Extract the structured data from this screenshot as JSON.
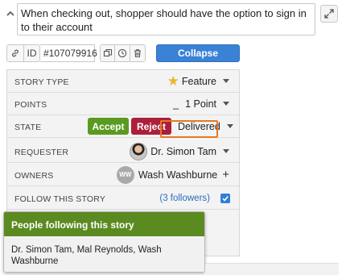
{
  "story": {
    "title": "When checking out, shopper should have the option to sign in to their account"
  },
  "toolbar": {
    "id_label": "ID",
    "id_value": "#107079916",
    "collapse_label": "Collapse"
  },
  "fields": {
    "story_type": {
      "label": "STORY TYPE",
      "value": "Feature",
      "icon": "star-icon"
    },
    "points": {
      "label": "POINTS",
      "value": "1 Point",
      "prefix": "_"
    },
    "state": {
      "label": "STATE",
      "accept_label": "Accept",
      "reject_label": "Reject",
      "value": "Delivered"
    },
    "requester": {
      "label": "REQUESTER",
      "value": "Dr. Simon Tam"
    },
    "owners": {
      "label": "OWNERS",
      "initials": "WW",
      "value": "Wash Washburne"
    },
    "follow": {
      "label": "FOLLOW THIS STORY",
      "followers_link": "(3 followers)",
      "checked": true
    }
  },
  "popover": {
    "title": "People following this story",
    "body": "Dr. Simon Tam, Mal Reynolds, Wash Washburne"
  },
  "colors": {
    "accent_blue": "#3a82d6",
    "accept_green": "#5a9a1f",
    "reject_red": "#ab1f3b",
    "highlight_orange": "#e87722",
    "popover_green": "#5b8a21",
    "star_gold": "#e9b82d"
  }
}
